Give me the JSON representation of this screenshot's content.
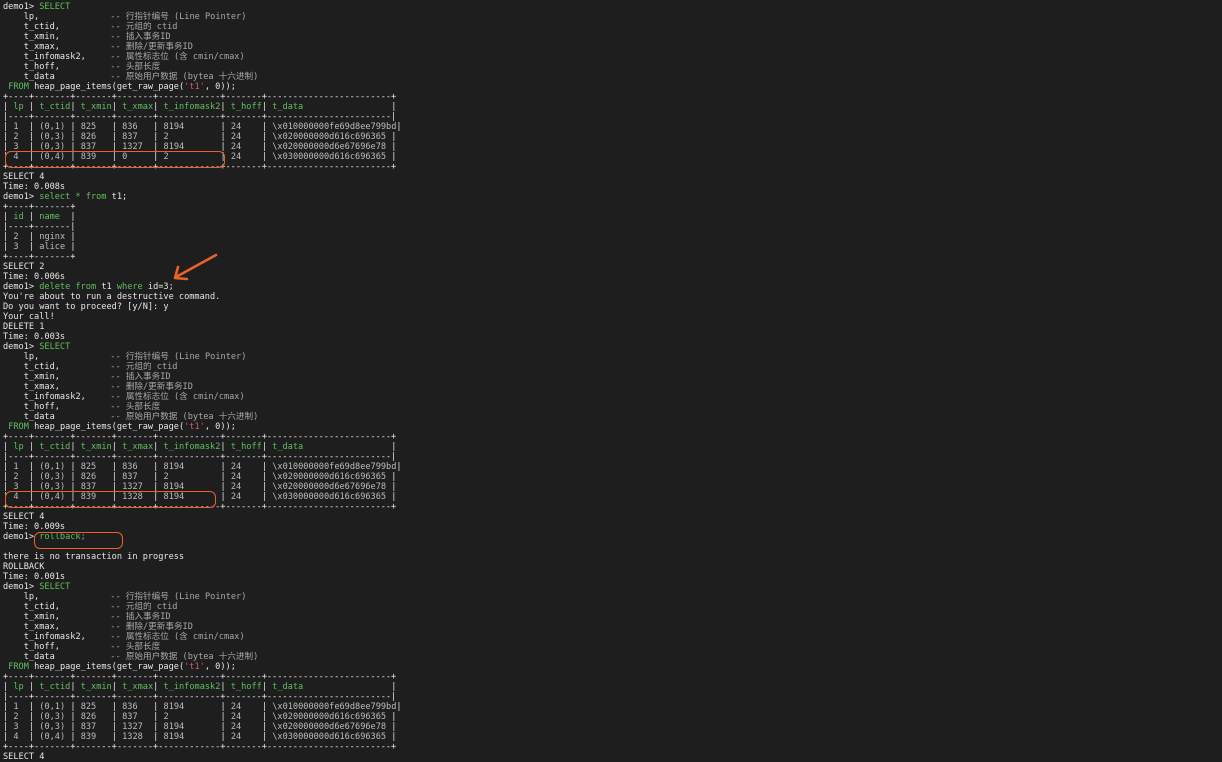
{
  "prompt": "demo1> ",
  "kw": {
    "select": "SELECT",
    "from": "FROM",
    "where": "where",
    "delete_from": "delete from",
    "select_star": "select * from"
  },
  "cols": [
    {
      "name": "lp,",
      "comment": "-- 行指针编号 (Line Pointer)"
    },
    {
      "name": "t_ctid,",
      "comment": "-- 元组的 ctid"
    },
    {
      "name": "t_xmin,",
      "comment": "-- 插入事务ID"
    },
    {
      "name": "t_xmax,",
      "comment": "-- 删除/更新事务ID"
    },
    {
      "name": "t_infomask2,",
      "comment": "-- 属性标志位 (含 cmin/cmax)"
    },
    {
      "name": "t_hoff,",
      "comment": "-- 头部长度"
    },
    {
      "name": "t_data",
      "comment": "-- 原始用户数据 (bytea 十六进制)"
    }
  ],
  "from_fn_pre": "heap_page_items(get_raw_page(",
  "from_fn_arg": "'t1'",
  "from_fn_post": ", 0));",
  "heap_headers": [
    "lp",
    "t_ctid",
    "t_xmin",
    "t_xmax",
    "t_infomask2",
    "t_hoff",
    "t_data"
  ],
  "heap1": [
    [
      "1",
      "(0,1)",
      "825",
      "836",
      "8194",
      "24",
      "\\x010000000fe69d8ee799bd"
    ],
    [
      "2",
      "(0,3)",
      "826",
      "837",
      "2",
      "24",
      "\\x020000000d616c696365"
    ],
    [
      "3",
      "(0,3)",
      "837",
      "1327",
      "8194",
      "24",
      "\\x020000000d6e67696e78"
    ],
    [
      "4",
      "(0,4)",
      "839",
      "0",
      "2",
      "24",
      "\\x030000000d616c696365"
    ]
  ],
  "heap2": [
    [
      "1",
      "(0,1)",
      "825",
      "836",
      "8194",
      "24",
      "\\x010000000fe69d8ee799bd"
    ],
    [
      "2",
      "(0,3)",
      "826",
      "837",
      "2",
      "24",
      "\\x020000000d616c696365"
    ],
    [
      "3",
      "(0,3)",
      "837",
      "1327",
      "8194",
      "24",
      "\\x020000000d6e67696e78"
    ],
    [
      "4",
      "(0,4)",
      "839",
      "1328",
      "8194",
      "24",
      "\\x030000000d616c696365"
    ]
  ],
  "heap3": [
    [
      "1",
      "(0,1)",
      "825",
      "836",
      "8194",
      "24",
      "\\x010000000fe69d8ee799bd"
    ],
    [
      "2",
      "(0,3)",
      "826",
      "837",
      "2",
      "24",
      "\\x020000000d616c696365"
    ],
    [
      "3",
      "(0,3)",
      "837",
      "1327",
      "8194",
      "24",
      "\\x020000000d6e67696e78"
    ],
    [
      "4",
      "(0,4)",
      "839",
      "1328",
      "8194",
      "24",
      "\\x030000000d616c696365"
    ]
  ],
  "t1_headers": [
    "id",
    "name"
  ],
  "t1_rows": [
    [
      "2",
      "nginx"
    ],
    [
      "3",
      "alice"
    ]
  ],
  "msgs": {
    "select4": "SELECT 4",
    "time1": "Time: 0.008s",
    "t1_table": "t1;",
    "select2": "SELECT 2",
    "time2": "Time: 0.006s",
    "del_t1": " t1 ",
    "del_cond": " id=3;",
    "warn1": "You're about to run a destructive command.",
    "warn2": "Do you want to proceed? [y/N]: y",
    "warn3": "Your call!",
    "delete1": "DELETE 1",
    "time3": "Time: 0.003s",
    "select4b": "SELECT 4",
    "time4": "Time: 0.009s",
    "rollback": "rollback;",
    "no_txn": "there is no transaction in progress",
    "rollback_tag": "ROLLBACK",
    "time5": "Time: 0.001s",
    "select4c": "SELECT 4"
  },
  "colors": {
    "keyword": "#5fbf5f",
    "string": "#d45b5b",
    "highlight": "#e8632a",
    "background": "#1e1e1e"
  }
}
